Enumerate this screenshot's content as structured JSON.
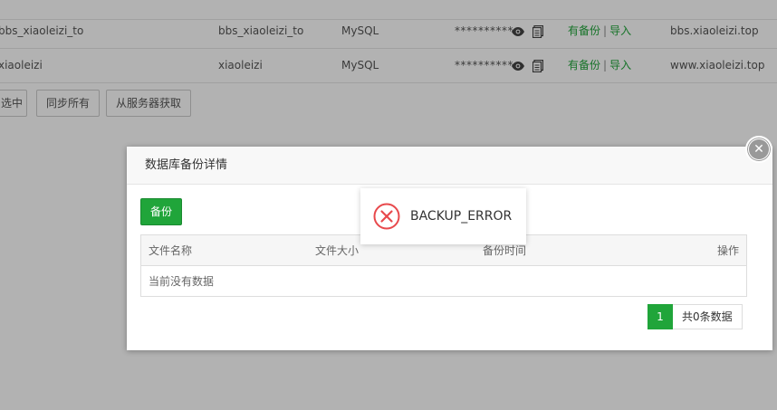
{
  "db_table": {
    "rows": [
      {
        "name": "bbs_xiaoleizi_to",
        "user": "bbs_xiaoleizi_to",
        "type": "MySQL",
        "password": "**********",
        "backup": "有备份",
        "import": "导入",
        "site": "bbs.xiaoleizi.top"
      },
      {
        "name": "xiaoleizi",
        "user": "xiaoleizi",
        "type": "MySQL",
        "password": "**********",
        "backup": "有备份",
        "import": "导入",
        "site": "www.xiaoleizi.top"
      }
    ],
    "actions": {
      "delete_selected": "选中",
      "sync_all": "同步所有",
      "fetch_from_server": "从服务器获取"
    }
  },
  "dialog": {
    "title": "数据库备份详情",
    "backup_button": "备份",
    "columns": {
      "file_name": "文件名称",
      "file_size": "文件大小",
      "backup_time": "备份时间",
      "operations": "操作"
    },
    "empty_text": "当前没有数据",
    "pager": {
      "current_page": "1",
      "total_text": "共0条数据"
    }
  },
  "toast": {
    "message": "BACKUP_ERROR"
  },
  "colors": {
    "accent_green": "#20a53a",
    "error_red": "#e8494c",
    "overlay": "rgba(0,0,0,0.3)"
  }
}
